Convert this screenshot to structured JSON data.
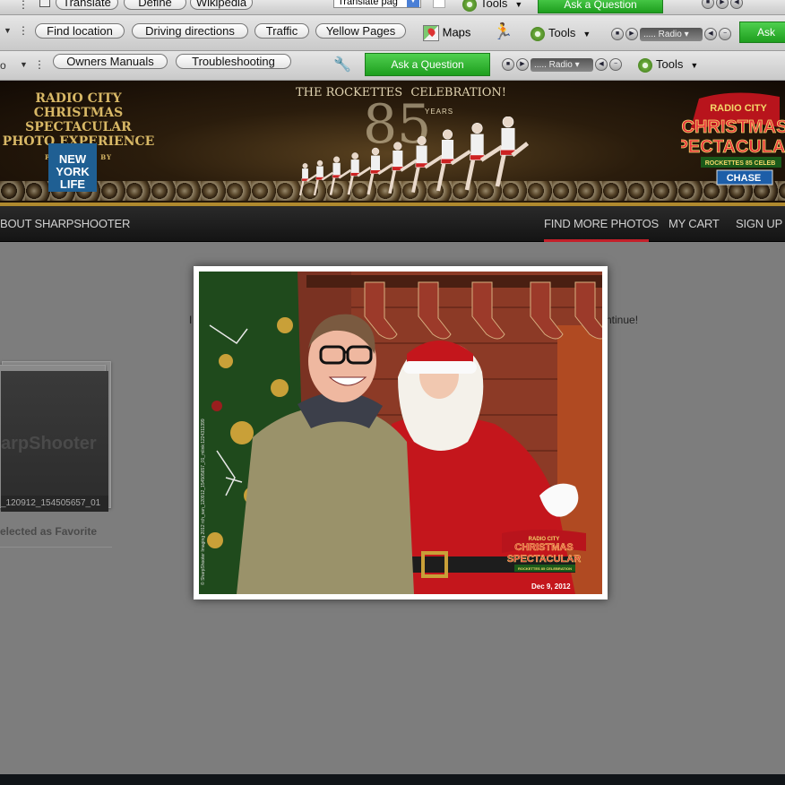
{
  "toolbar1": {
    "buttons": [
      "Translate",
      "Define",
      "Wikipedia"
    ],
    "translate_select": "Translate pag",
    "tools_label": "Tools",
    "ask_label": "Ask a Question"
  },
  "toolbar2": {
    "buttons": [
      "Find location",
      "Driving directions",
      "Traffic",
      "Yellow Pages"
    ],
    "maps_label": "Maps",
    "tools_label": "Tools",
    "radio_label": "Radio",
    "ask_label": "Ask"
  },
  "toolbar3": {
    "left_fragment": "o",
    "buttons": [
      "Owners Manuals",
      "Troubleshooting"
    ],
    "ask_label": "Ask a Question",
    "radio_label": "Radio",
    "tools_label": "Tools"
  },
  "banner": {
    "left_title_lines": [
      "RADIO CITY",
      "CHRISTMAS SPECTACULAR",
      "PHOTO EXPERIENCE"
    ],
    "presented_by": "PRESENTED BY",
    "sponsor_lines": [
      "NEW",
      "YORK",
      "LIFE"
    ],
    "rockettes_left": "THE ROCKETTES",
    "rockettes_right": "CELEBRATION!",
    "anniversary": "85",
    "years": "YEARS",
    "right_logo_lines": [
      "RADIO CITY",
      "CHRISTMAS",
      "SPECTACULAR",
      "ROCKETTES 85 CELEB",
      "CHASE"
    ]
  },
  "nav": {
    "about": "BOUT SHARPSHOOTER",
    "find_more": "FIND MORE PHOTOS",
    "cart": "MY CART",
    "signup": "SIGN UP"
  },
  "content": {
    "thumb_logo": "arpShooter",
    "thumb_filename": "_120912_154505657_01",
    "favorite_text": "elected as Favorite",
    "behind_left": "I",
    "behind_right": "ntinue!"
  },
  "photo": {
    "date": "Dec 9, 2012",
    "logo_lines": [
      "RADIO CITY",
      "CHRISTMAS",
      "SPECTACULAR",
      "ROCKETTES 85 CELEBRATION"
    ],
    "side_text": "© SharpShooter Imaging 2012 rch_san_120912_154505657_01_mlink:1224311399"
  },
  "colors": {
    "ask_green": "#2db52d",
    "nav_active": "#c4202a",
    "banner_gold": "#d8b866"
  },
  "icons": [
    "gear-icon",
    "maps-icon",
    "runner-icon",
    "wrench-icon",
    "checkbox-icon",
    "play-icon",
    "volume-icon"
  ]
}
